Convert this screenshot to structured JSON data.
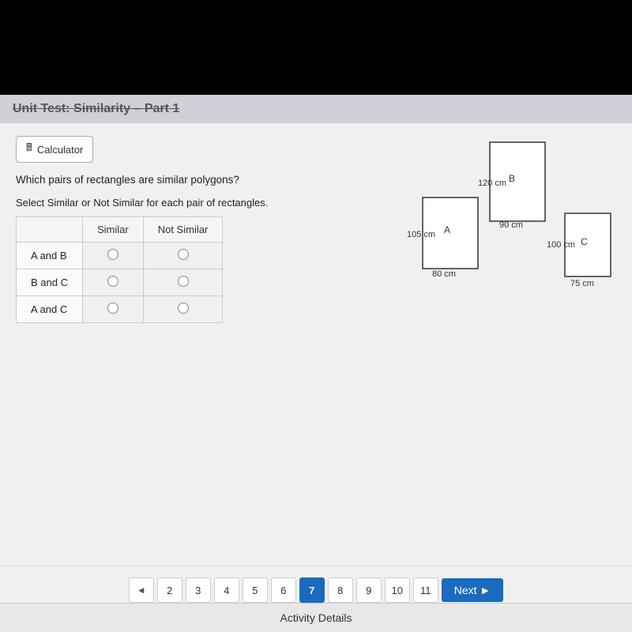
{
  "titleBar": {
    "text": "Unit Test: Similarity – Part 1"
  },
  "calculator": {
    "label": "Calculator"
  },
  "question": {
    "text": "Which pairs of rectangles are similar polygons?",
    "instruction": "Select Similar or Not Similar for each pair of rectangles."
  },
  "table": {
    "headers": [
      "",
      "Similar",
      "Not Similar"
    ],
    "rows": [
      {
        "label": "A and B"
      },
      {
        "label": "B and C"
      },
      {
        "label": "A and C"
      }
    ]
  },
  "rectangles": {
    "A": {
      "label": "A",
      "width": "80 cm",
      "height": "105 cm"
    },
    "B": {
      "label": "B",
      "width": "90 cm",
      "height": "120 cm"
    },
    "C": {
      "label": "C",
      "width": "75 cm",
      "height": "100 cm"
    }
  },
  "pagination": {
    "pages": [
      "2",
      "3",
      "4",
      "5",
      "6",
      "7",
      "8",
      "9",
      "10",
      "11"
    ],
    "activePage": "7",
    "prevLabel": "◄",
    "nextLabel": "Next ►"
  },
  "activityDetails": {
    "label": "Activity Details"
  }
}
